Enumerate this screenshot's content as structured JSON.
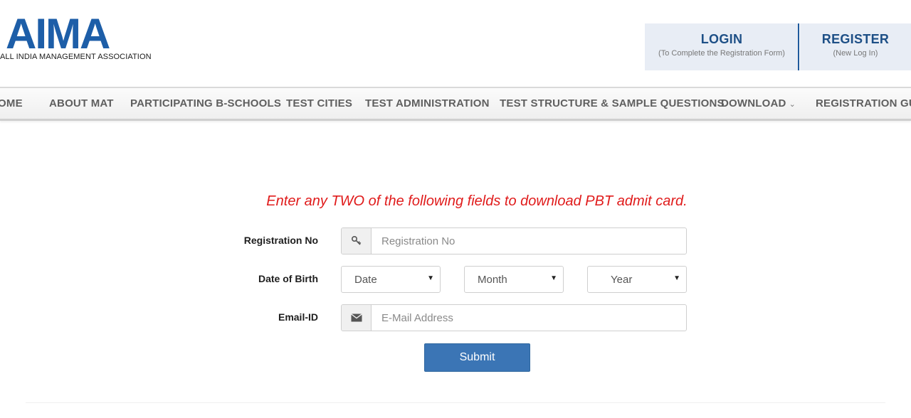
{
  "header": {
    "logo_text": "AIMA",
    "logo_subtitle": "ALL INDIA MANAGEMENT ASSOCIATION",
    "login": {
      "title": "LOGIN",
      "subtitle": "(To Complete the Registration Form)"
    },
    "register": {
      "title": "REGISTER",
      "subtitle": "(New Log In)"
    },
    "brand_color": "#1d5ea8"
  },
  "nav": {
    "items": [
      {
        "label": "HOME"
      },
      {
        "label": "ABOUT MAT"
      },
      {
        "label": "PARTICIPATING B-SCHOOLS"
      },
      {
        "label": "TEST CITIES"
      },
      {
        "label": "TEST ADMINISTRATION"
      },
      {
        "label": "TEST STRUCTURE & SAMPLE QUESTIONS"
      },
      {
        "label": "DOWNLOAD",
        "icon": "chevron-down-icon"
      },
      {
        "label": "REGISTRATION GUIDE"
      }
    ]
  },
  "form": {
    "notice": "Enter any TWO of the following fields to download PBT admit card.",
    "notice_color": "#e01b1b",
    "registration": {
      "label": "Registration No",
      "placeholder": "Registration No",
      "icon": "key-icon"
    },
    "dob": {
      "label": "Date of Birth",
      "date": "Date",
      "month": "Month",
      "year": "Year"
    },
    "email": {
      "label": "Email-ID",
      "placeholder": "E-Mail Address",
      "icon": "envelope-icon"
    },
    "submit_label": "Submit",
    "submit_color": "#3b75b5"
  }
}
